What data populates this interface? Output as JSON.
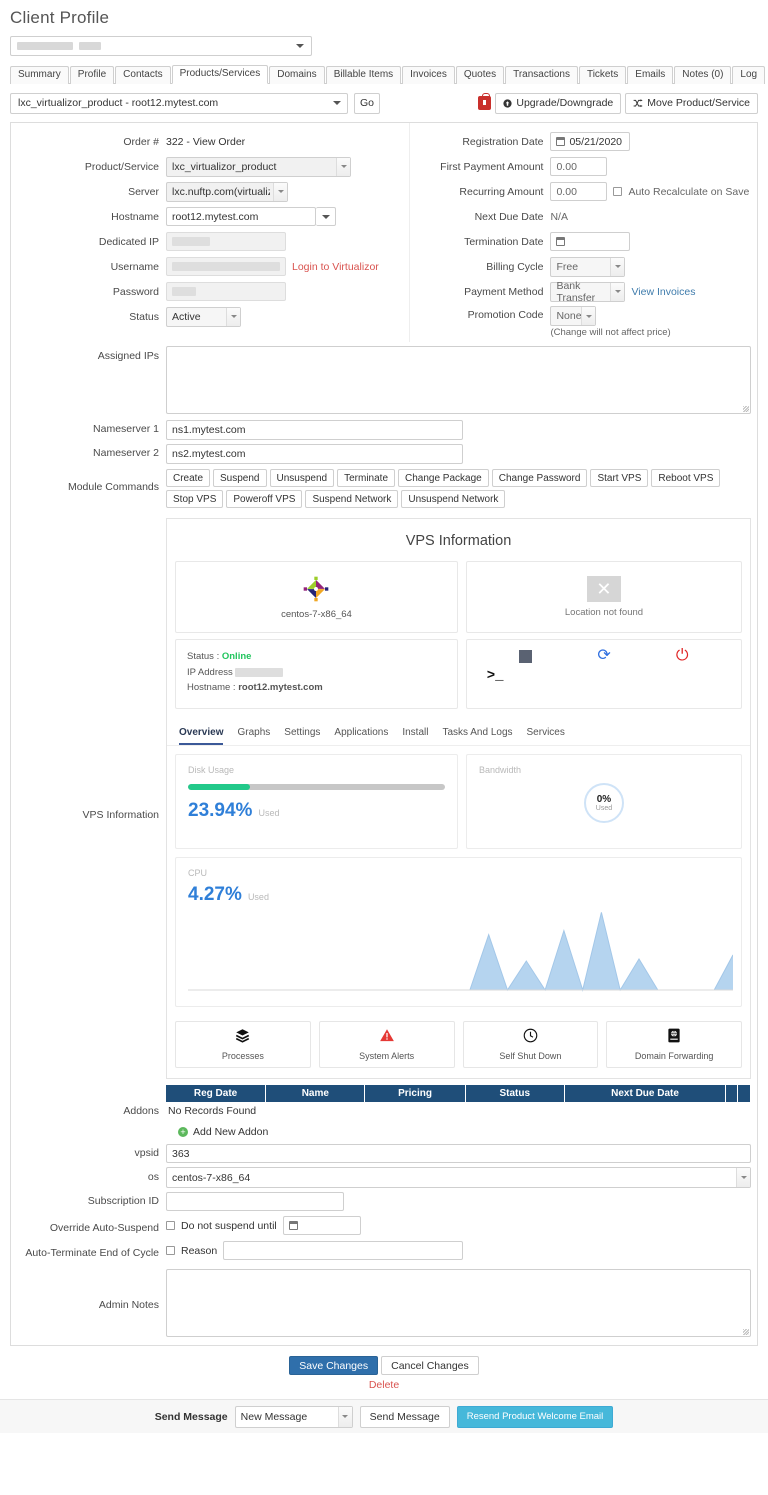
{
  "page": {
    "title": "Client Profile"
  },
  "client_selector": {
    "value": ""
  },
  "tabs": [
    {
      "label": "Summary",
      "active": false
    },
    {
      "label": "Profile",
      "active": false
    },
    {
      "label": "Contacts",
      "active": false
    },
    {
      "label": "Products/Services",
      "active": true
    },
    {
      "label": "Domains",
      "active": false
    },
    {
      "label": "Billable Items",
      "active": false
    },
    {
      "label": "Invoices",
      "active": false
    },
    {
      "label": "Quotes",
      "active": false
    },
    {
      "label": "Transactions",
      "active": false
    },
    {
      "label": "Tickets",
      "active": false
    },
    {
      "label": "Emails",
      "active": false
    },
    {
      "label": "Notes (0)",
      "active": false
    },
    {
      "label": "Log",
      "active": false
    }
  ],
  "product_bar": {
    "selected_product": "lxc_virtualizor_product - root12.mytest.com",
    "go_label": "Go",
    "upgrade_label": "Upgrade/Downgrade",
    "move_label": "Move Product/Service"
  },
  "left_fields": {
    "order_label": "Order #",
    "order_value": "322 - View Order",
    "product_label": "Product/Service",
    "product_value": "lxc_virtualizor_product",
    "server_label": "Server",
    "server_value": "lxc.nuftp.com(virtualizor) (",
    "hostname_label": "Hostname",
    "hostname_value": "root12.mytest.com",
    "dedicated_ip_label": "Dedicated IP",
    "dedicated_ip_value": "",
    "username_label": "Username",
    "username_value": "",
    "login_link": "Login to Virtualizor",
    "password_label": "Password",
    "password_value": "",
    "status_label": "Status",
    "status_value": "Active"
  },
  "right_fields": {
    "reg_date_label": "Registration Date",
    "reg_date_value": "05/21/2020",
    "first_payment_label": "First Payment Amount",
    "first_payment_value": "0.00",
    "recurring_label": "Recurring Amount",
    "recurring_value": "0.00",
    "auto_recalc_label": "Auto Recalculate on Save",
    "next_due_label": "Next Due Date",
    "next_due_value": "N/A",
    "termination_label": "Termination Date",
    "termination_value": "",
    "billing_cycle_label": "Billing Cycle",
    "billing_cycle_value": "Free",
    "payment_method_label": "Payment Method",
    "payment_method_value": "Bank Transfer",
    "view_invoices_link": "View Invoices",
    "promotion_label": "Promotion Code",
    "promotion_value": "None",
    "promotion_note": "(Change will not affect price)"
  },
  "assigned_ips": {
    "label": "Assigned IPs",
    "value": ""
  },
  "nameserver1": {
    "label": "Nameserver 1",
    "value": "ns1.mytest.com"
  },
  "nameserver2": {
    "label": "Nameserver 2",
    "value": "ns2.mytest.com"
  },
  "module_commands": {
    "label": "Module Commands",
    "buttons": [
      "Create",
      "Suspend",
      "Unsuspend",
      "Terminate",
      "Change Package",
      "Change Password",
      "Start VPS",
      "Reboot VPS",
      "Stop VPS",
      "Poweroff VPS",
      "Suspend Network",
      "Unsuspend Network"
    ]
  },
  "vps": {
    "section_label": "VPS Information",
    "title": "VPS Information",
    "os_name": "centos-7-x86_64",
    "location_text": "Location not found",
    "status_label": "Status :",
    "status_value": "Online",
    "ip_label": "IP Address",
    "ip_value": "",
    "hostname_label": "Hostname :",
    "hostname_value": "root12.mytest.com",
    "controls": [
      "stop-icon",
      "reload-icon",
      "power-icon",
      "terminal-icon"
    ],
    "tabs": [
      {
        "label": "Overview",
        "active": true
      },
      {
        "label": "Graphs",
        "active": false
      },
      {
        "label": "Settings",
        "active": false
      },
      {
        "label": "Applications",
        "active": false
      },
      {
        "label": "Install",
        "active": false
      },
      {
        "label": "Tasks And Logs",
        "active": false
      },
      {
        "label": "Services",
        "active": false
      }
    ],
    "disk": {
      "title": "Disk Usage",
      "percent": "23.94%",
      "used_label": "Used",
      "fill_pct": 23.94
    },
    "bandwidth": {
      "title": "Bandwidth",
      "percent": "0%",
      "used_label": "Used",
      "fill_pct": 0
    },
    "cpu": {
      "title": "CPU",
      "percent": "4.27%",
      "used_label": "Used"
    },
    "tiles": [
      {
        "label": "Processes",
        "icon": "layers-icon"
      },
      {
        "label": "System Alerts",
        "icon": "warning-icon"
      },
      {
        "label": "Self Shut Down",
        "icon": "clock-icon"
      },
      {
        "label": "Domain Forwarding",
        "icon": "server-globe-icon"
      }
    ]
  },
  "chart_data": {
    "type": "area",
    "title": "CPU",
    "xlabel": "",
    "ylabel": "",
    "ylim": [
      0,
      12
    ],
    "grid": false,
    "legend": "none",
    "annotations": [
      "4.27% Used"
    ],
    "x": [
      0,
      1,
      2,
      3,
      4,
      5,
      6,
      7,
      8,
      9,
      10,
      11,
      12,
      13,
      14,
      15,
      16,
      17,
      18,
      19,
      20,
      21,
      22,
      23,
      24,
      25,
      26
    ],
    "values": [
      0,
      0,
      0,
      0,
      0,
      0,
      0,
      0,
      0,
      0,
      0,
      0,
      0,
      0,
      0,
      0,
      8.2,
      0,
      4.3,
      0,
      8.8,
      0,
      11.5,
      0,
      4.6,
      0,
      0,
      0,
      0,
      5.2
    ]
  },
  "addons": {
    "label": "Addons",
    "columns": [
      "Reg Date",
      "Name",
      "Pricing",
      "Status",
      "Next Due Date",
      "",
      ""
    ],
    "no_records": "No Records Found",
    "add_new": "Add New Addon"
  },
  "bottom_fields": {
    "vpsid_label": "vpsid",
    "vpsid_value": "363",
    "os_label": "os",
    "os_value": "centos-7-x86_64",
    "subscription_label": "Subscription ID",
    "subscription_value": "",
    "override_label": "Override Auto-Suspend",
    "override_text": "Do not suspend until",
    "override_date": "",
    "autoterm_label": "Auto-Terminate End of Cycle",
    "autoterm_text": "Reason",
    "autoterm_value": "",
    "admin_notes_label": "Admin Notes",
    "admin_notes_value": ""
  },
  "footer": {
    "save_label": "Save Changes",
    "cancel_label": "Cancel Changes",
    "delete_label": "Delete",
    "send_message_label": "Send Message",
    "message_select": "New Message",
    "send_message_button": "Send Message",
    "resend_label": "Resend Product Welcome Email"
  },
  "colors": {
    "accent_blue": "#2f6fab",
    "table_header": "#1f4e79",
    "danger": "#d9534f",
    "success": "#22c98a",
    "chart_fill": "#a8cdec"
  }
}
